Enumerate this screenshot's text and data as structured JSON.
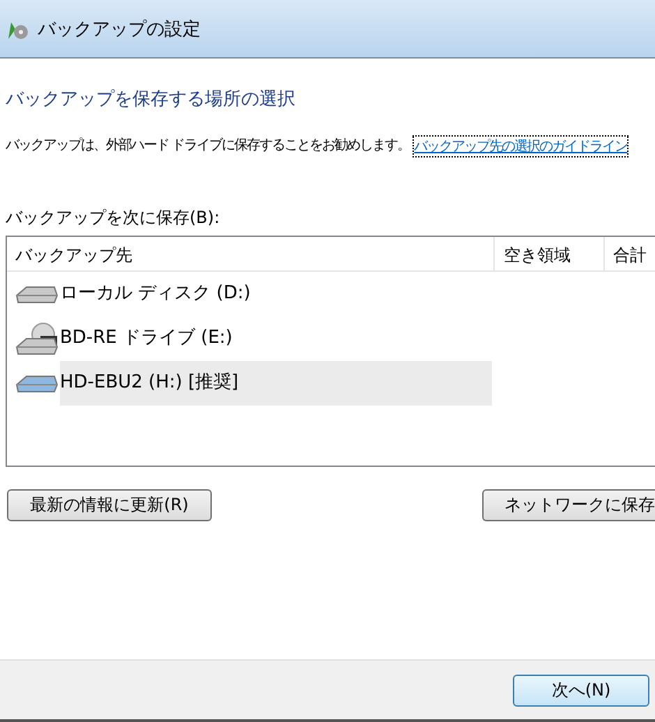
{
  "window": {
    "title": "バックアップの設定"
  },
  "heading": "バックアップを保存する場所の選択",
  "description": {
    "text": "バックアップは、外部ハード ドライブに保存することをお勧めします。",
    "link": "バックアップ先の選択のガイドライン"
  },
  "list_label": "バックアップを次に保存(B):",
  "table": {
    "columns": [
      "バックアップ先",
      "空き領域",
      "合計"
    ],
    "rows": [
      {
        "kind": "disk",
        "name": "ローカル ディスク (D:)",
        "selected": false
      },
      {
        "kind": "bd",
        "name": "BD-RE ドライブ (E:)",
        "selected": false
      },
      {
        "kind": "usb",
        "name": "HD-EBU2 (H:) [推奨]",
        "selected": true
      }
    ]
  },
  "buttons": {
    "refresh": "最新の情報に更新(R)",
    "network": "ネットワークに保存"
  },
  "footer": {
    "next": "次へ(N)"
  }
}
